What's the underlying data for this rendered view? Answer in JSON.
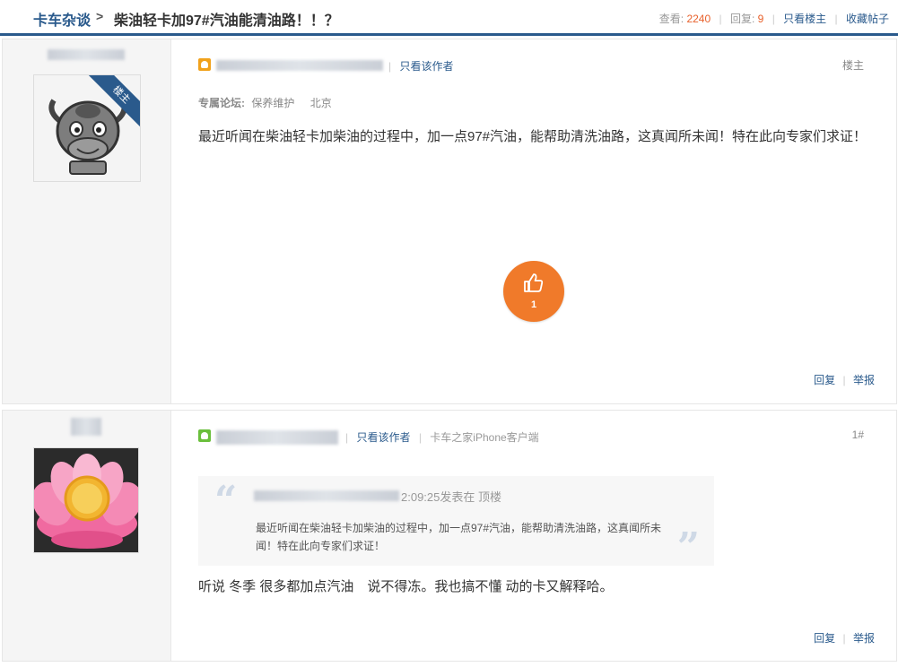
{
  "header": {
    "forum": "卡车杂谈",
    "separator": ">",
    "title": "柴油轻卡加97#汽油能清油路！！？",
    "views_label": "查看:",
    "views": "2240",
    "replies_label": "回复:",
    "replies": "9",
    "only_host": "只看楼主",
    "favorite": "收藏帖子"
  },
  "posts": [
    {
      "ribbon": "楼主",
      "only_author": "只看该作者",
      "floor": "楼主",
      "forum_label": "专属论坛:",
      "forum_name": "保养维护",
      "location": "北京",
      "content": "最近听闻在柴油轻卡加柴油的过程中，加一点97#汽油，能帮助清洗油路，这真闻所未闻！特在此向专家们求证！",
      "likes": "1",
      "reply": "回复",
      "report": "举报"
    },
    {
      "only_author": "只看该作者",
      "client": "卡车之家iPhone客户端",
      "floor": "1#",
      "quote_time": "2:09:25发表在 顶楼",
      "quote_text": "最近听闻在柴油轻卡加柴油的过程中，加一点97#汽油，能帮助清洗油路，这真闻所未闻！特在此向专家们求证！",
      "quote_open": "“",
      "quote_close": "”",
      "content": "听说 冬季 很多都加点汽油　说不得冻。我也搞不懂  动的卡又解释哈。",
      "reply": "回复",
      "report": "举报"
    }
  ],
  "colors": {
    "brand": "#2a5a8c",
    "accent": "#e8612c",
    "like": "#f07a2a"
  }
}
